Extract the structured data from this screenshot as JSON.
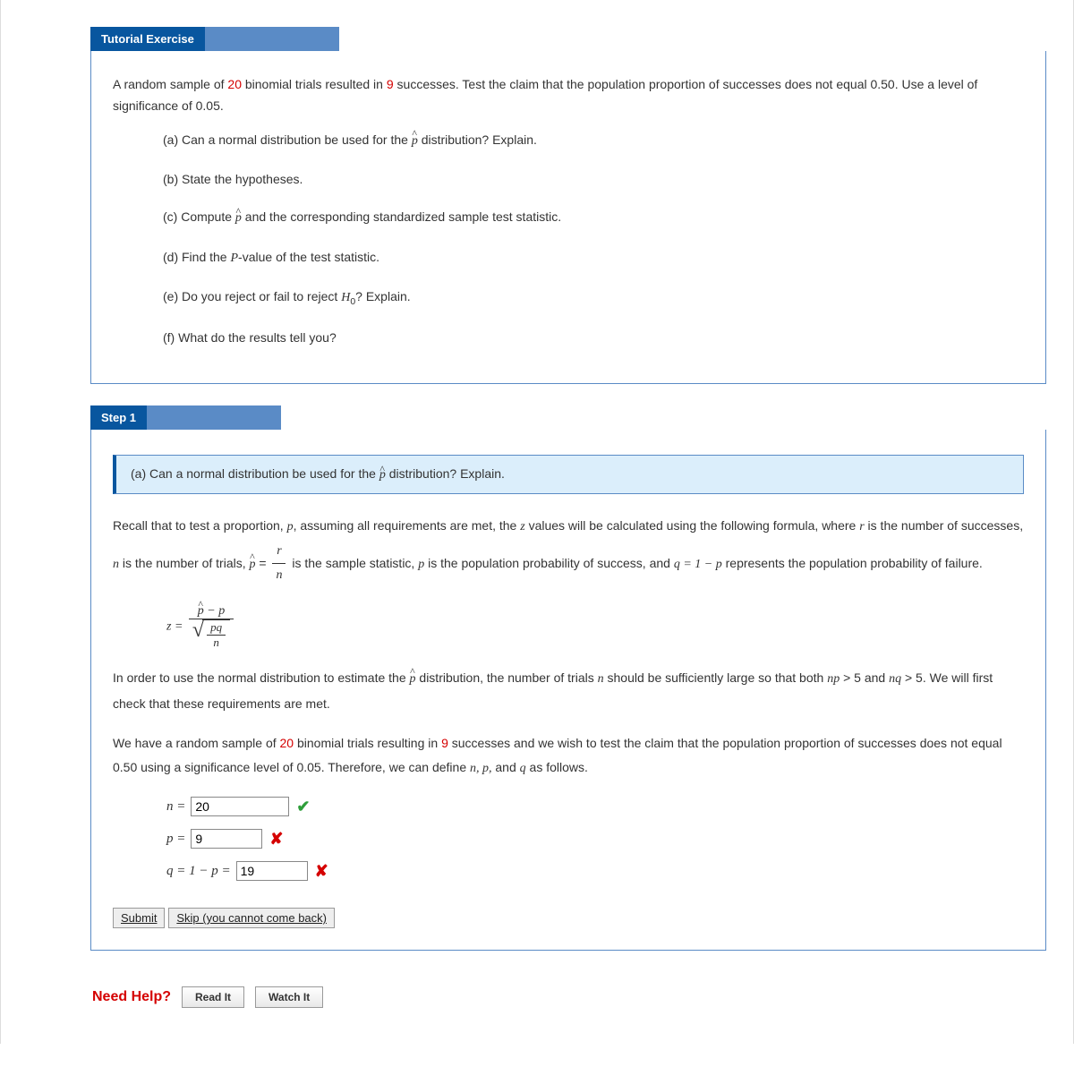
{
  "tutorial": {
    "chip": "Tutorial Exercise",
    "prompt_pre": "A random sample of ",
    "n_trials": "20",
    "prompt_mid": " binomial trials resulted in ",
    "n_success": "9",
    "prompt_post": " successes. Test the claim that the population proportion of successes does not equal 0.50. Use a level of significance of 0.05.",
    "parts": {
      "a_pre": "(a) Can a normal distribution be used for the ",
      "a_post": " distribution? Explain.",
      "b": "(b) State the hypotheses.",
      "c_pre": "(c) Compute ",
      "c_post": " and the corresponding standardized sample test statistic.",
      "d_pre": "(d) Find the ",
      "d_mid": "P",
      "d_post": "-value of the test statistic.",
      "e_pre": "(e) Do you reject or fail to reject ",
      "e_h": "H",
      "e_sub": "0",
      "e_post": "? Explain.",
      "f": "(f) What do the results tell you?"
    }
  },
  "step": {
    "chip": "Step 1",
    "callout_pre": "(a) Can a normal distribution be used for the ",
    "callout_post": " distribution? Explain.",
    "para1_a": "Recall that to test a proportion, ",
    "para1_b": ", assuming all requirements are met, the ",
    "para1_c": " values will be calculated using the following formula, where ",
    "para1_d": " is the number of successes, ",
    "para1_e": " is the number of trials, ",
    "para1_f": " is the sample statistic, ",
    "para1_g": " is the population probability of success, and ",
    "para1_h": " represents the population probability of failure.",
    "var_p": "p",
    "var_z": "z",
    "var_r": "r",
    "var_n": "n",
    "var_q_eq": "q = 1 − p",
    "formula_z_eq": "z =",
    "formula_num_text": "− p",
    "formula_den_num": "pq",
    "formula_den_den": "n",
    "para2_pre": "In order to use the normal distribution to estimate the ",
    "para2_mid": " distribution, the number of trials ",
    "para2_n": "n",
    "para2_post1": " should be sufficiently large so that both ",
    "para2_np": "np",
    "para2_gt1": " > 5 and ",
    "para2_nq": "nq",
    "para2_gt2": " > 5. We will first check that these requirements are met.",
    "para3_a": "We have a random sample of ",
    "para3_n": "20",
    "para3_b": " binomial trials resulting in ",
    "para3_s": "9",
    "para3_c": " successes and we wish to test the claim that the population proportion of successes does not equal 0.50 using a significance level of 0.05. Therefore, we can define ",
    "para3_vars": "n, p,",
    "para3_and": " and ",
    "para3_q": "q",
    "para3_end": " as follows.",
    "inputs": {
      "n_label": "n  =",
      "n_value": "20",
      "n_status": "correct",
      "p_label": "p  =",
      "p_value": "9",
      "p_status": "incorrect",
      "q_label": "q  =  1 − p  =",
      "q_value": "19",
      "q_status": "incorrect"
    },
    "submit": "Submit",
    "skip": "Skip (you cannot come back)"
  },
  "help": {
    "label": "Need Help?",
    "read": "Read It",
    "watch": "Watch It"
  }
}
